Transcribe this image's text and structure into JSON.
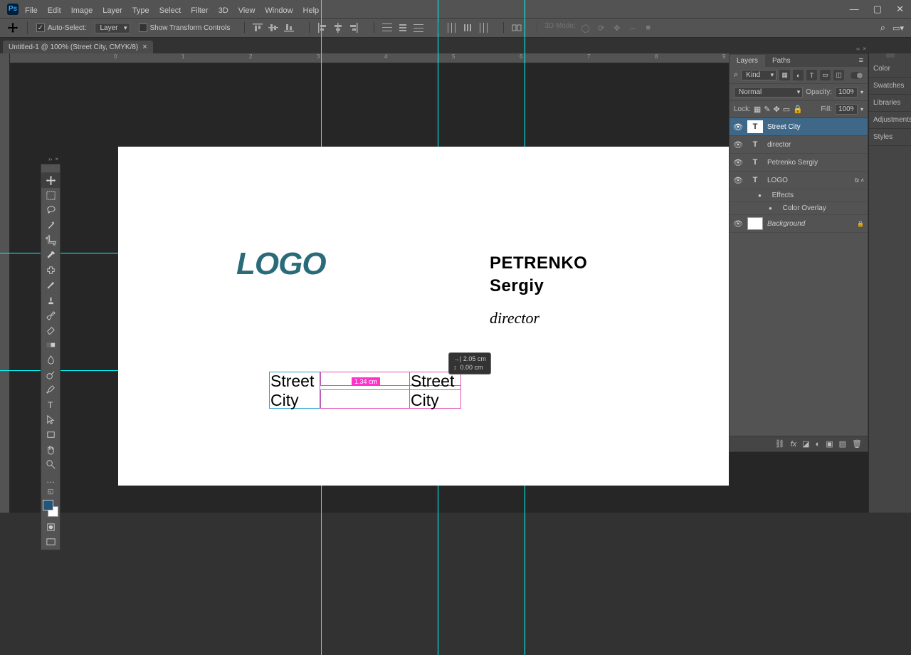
{
  "menu": [
    "File",
    "Edit",
    "Image",
    "Layer",
    "Type",
    "Select",
    "Filter",
    "3D",
    "View",
    "Window",
    "Help"
  ],
  "options": {
    "autoSelect": "Auto-Select:",
    "layer": "Layer",
    "showTransform": "Show Transform Controls",
    "threeDMode": "3D Mode:"
  },
  "docTab": "Untitled-1 @ 100% (Street City, CMYK/8)",
  "rulerMarks": [
    "0",
    "1",
    "2",
    "3",
    "4",
    "5",
    "6",
    "7",
    "8",
    "9"
  ],
  "canvas": {
    "logo": "LOGO",
    "nameLine1": "PETRENKO",
    "nameLine2": "Sergiy",
    "role": "director",
    "street": "Street",
    "city": "City",
    "smartGuideDim": "1.34 cm",
    "moveHud": {
      "dx": "2.05 cm",
      "dy": "0.00 cm"
    }
  },
  "rightTabs": [
    "Color",
    "Swatches",
    "Libraries",
    "Adjustments",
    "Styles"
  ],
  "layersPanel": {
    "tabs": [
      "Layers",
      "Paths"
    ],
    "kind": "Kind",
    "blend": "Normal",
    "opacityLabel": "Opacity:",
    "opacity": "100%",
    "lockLabel": "Lock:",
    "fillLabel": "Fill:",
    "fill": "100%",
    "layers": [
      {
        "name": "Street City",
        "type": "T",
        "selected": true
      },
      {
        "name": "director",
        "type": "T"
      },
      {
        "name": "Petrenko Sergiy",
        "type": "T"
      },
      {
        "name": "LOGO",
        "type": "T",
        "fx": true
      },
      {
        "name": "Effects",
        "sub": true
      },
      {
        "name": "Color Overlay",
        "sub2": true
      },
      {
        "name": "Background",
        "type": "bg",
        "locked": true
      }
    ]
  }
}
